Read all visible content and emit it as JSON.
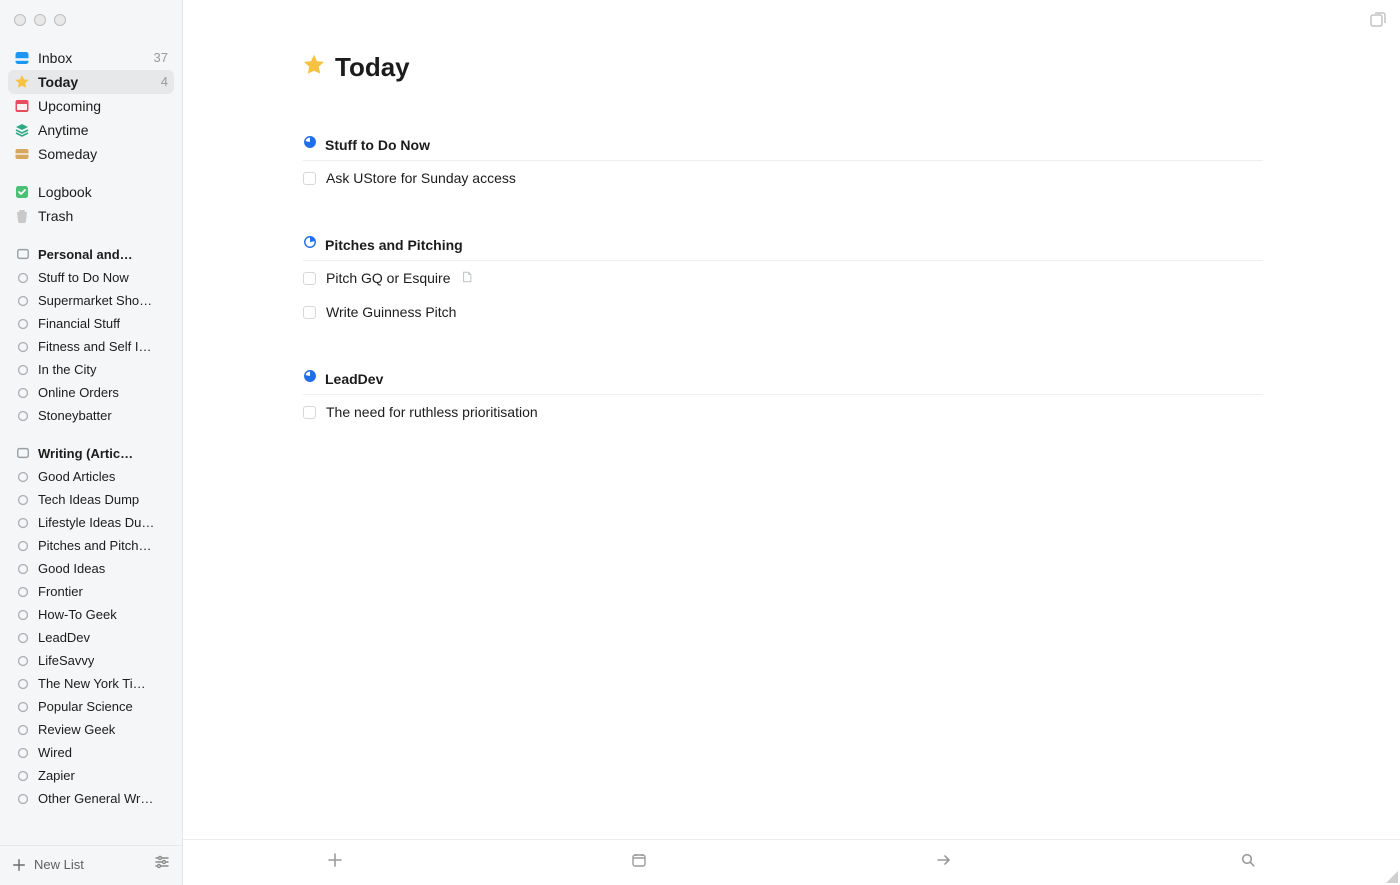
{
  "page_title": "Today",
  "sidebar": {
    "top": [
      {
        "name": "inbox",
        "icon": "inbox",
        "label": "Inbox",
        "badge": "37",
        "selected": false
      },
      {
        "name": "today",
        "icon": "star",
        "label": "Today",
        "badge": "4",
        "selected": true
      },
      {
        "name": "upcoming",
        "icon": "calendar",
        "label": "Upcoming",
        "badge": "",
        "selected": false
      },
      {
        "name": "anytime",
        "icon": "layers",
        "label": "Anytime",
        "badge": "",
        "selected": false
      },
      {
        "name": "someday",
        "icon": "drawer",
        "label": "Someday",
        "badge": "",
        "selected": false
      }
    ],
    "mid": [
      {
        "name": "logbook",
        "icon": "logbook",
        "label": "Logbook"
      },
      {
        "name": "trash",
        "icon": "trash",
        "label": "Trash"
      }
    ],
    "areas": [
      {
        "name": "personal",
        "title": "Personal and…",
        "items": [
          "Stuff to Do Now",
          "Supermarket Sho…",
          "Financial Stuff",
          "Fitness and Self I…",
          "In the City",
          "Online Orders",
          "Stoneybatter"
        ]
      },
      {
        "name": "writing",
        "title": "Writing (Artic…",
        "items": [
          "Good Articles",
          "Tech Ideas Dump",
          "Lifestyle Ideas Du…",
          "Pitches and Pitch…",
          "Good Ideas",
          "Frontier",
          "How-To Geek",
          "LeadDev",
          "LifeSavvy",
          "The New York Ti…",
          "Popular Science",
          "Review Geek",
          "Wired",
          "Zapier",
          "Other General Wr…"
        ]
      }
    ],
    "new_list_label": "New List"
  },
  "sections": [
    {
      "name": "stuff-to-do-now",
      "title": "Stuff to Do Now",
      "pie": "three-quarters",
      "tasks": [
        {
          "text": "Ask UStore for Sunday access",
          "note": false
        }
      ]
    },
    {
      "name": "pitches-and-pitching",
      "title": "Pitches and Pitching",
      "pie": "quarter",
      "tasks": [
        {
          "text": "Pitch GQ or Esquire",
          "note": true
        },
        {
          "text": "Write Guinness Pitch",
          "note": false
        }
      ]
    },
    {
      "name": "leaddev",
      "title": "LeadDev",
      "pie": "three-quarters",
      "tasks": [
        {
          "text": "The need for ruthless prioritisation",
          "note": false
        }
      ]
    }
  ],
  "toolbar": {
    "add": "plus-icon",
    "date": "calendar-icon",
    "move": "arrow-right-icon",
    "search": "search-icon"
  }
}
